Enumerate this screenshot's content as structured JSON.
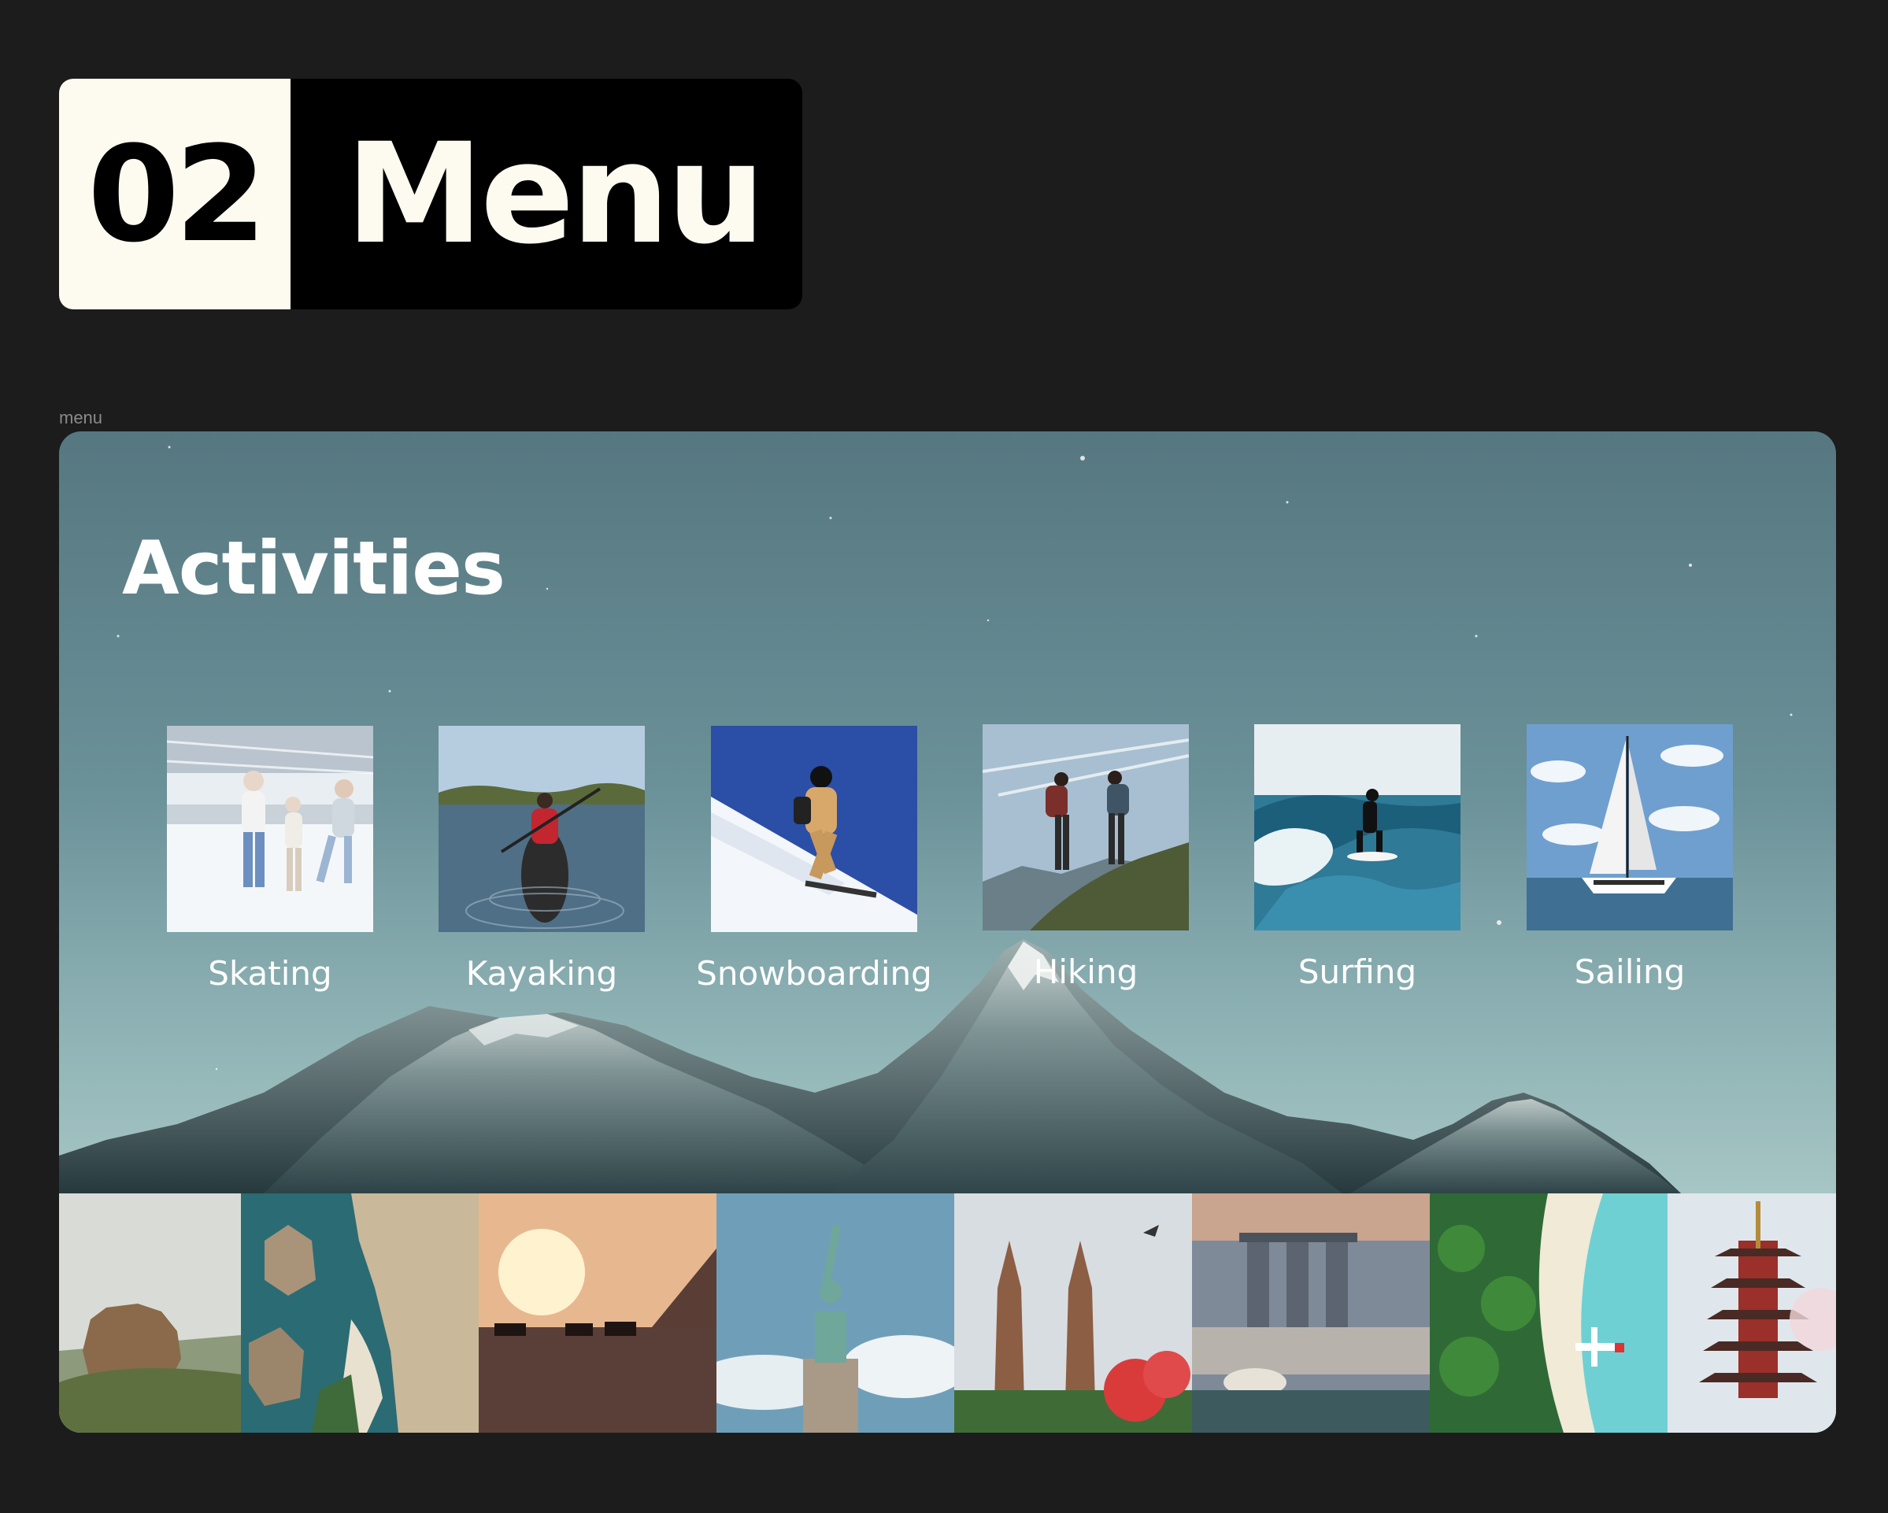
{
  "section": {
    "number": "02",
    "title": "Menu"
  },
  "frame": {
    "label": "menu"
  },
  "card": {
    "title": "Activities",
    "activities": [
      {
        "label": "Skating",
        "icon": "ice-skating-photo"
      },
      {
        "label": "Kayaking",
        "icon": "kayaking-photo"
      },
      {
        "label": "Snowboarding",
        "icon": "snowboarding-photo"
      },
      {
        "label": "Hiking",
        "icon": "hiking-photo"
      },
      {
        "label": "Surfing",
        "icon": "surfing-photo"
      },
      {
        "label": "Sailing",
        "icon": "sailing-photo"
      }
    ],
    "destinations": [
      {
        "icon": "sigiriya-rock-photo"
      },
      {
        "icon": "coastal-cliffs-photo"
      },
      {
        "icon": "desert-pyramids-photo"
      },
      {
        "icon": "statue-of-liberty-photo"
      },
      {
        "icon": "bali-temple-gate-photo"
      },
      {
        "icon": "singapore-marina-bay-photo"
      },
      {
        "icon": "maldives-beach-seaplane-photo"
      },
      {
        "icon": "japanese-pagoda-photo"
      }
    ]
  },
  "colors": {
    "page_background": "#1c1c1c",
    "badge_number_bg": "#fdfbf0",
    "badge_title_bg": "#000000",
    "text_light": "#ffffff"
  }
}
